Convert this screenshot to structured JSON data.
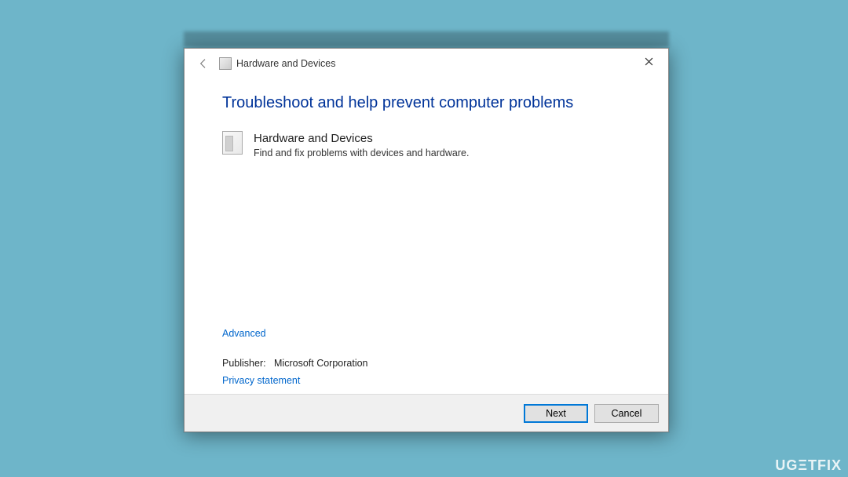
{
  "dialog": {
    "title": "Hardware and Devices",
    "heading": "Troubleshoot and help prevent computer problems",
    "item": {
      "title": "Hardware and Devices",
      "desc": "Find and fix problems with devices and hardware."
    },
    "advanced_label": "Advanced",
    "publisher_label": "Publisher:",
    "publisher_value": "Microsoft Corporation",
    "privacy_label": "Privacy statement",
    "buttons": {
      "next": "Next",
      "cancel": "Cancel"
    }
  },
  "watermark": "UGΞTFIX"
}
